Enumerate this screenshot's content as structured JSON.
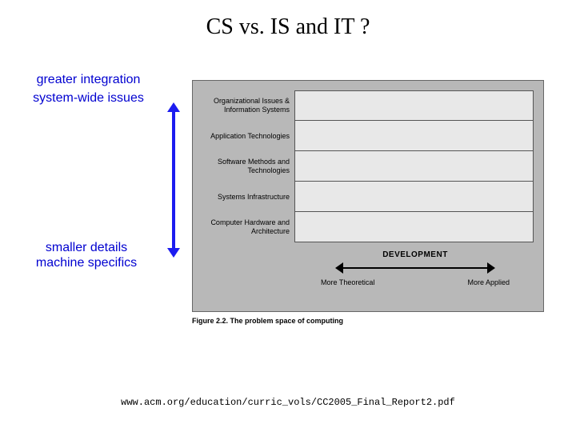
{
  "title": "CS vs. IS and IT  ?",
  "annotations": {
    "top_line1": "greater integration",
    "top_line2": "system-wide issues",
    "bottom_line1": "smaller details",
    "bottom_line2": "machine specifics"
  },
  "figure": {
    "rows": [
      "Organizational Issues & Information Systems",
      "Application Technologies",
      "Software Methods and Technologies",
      "Systems Infrastructure",
      "Computer Hardware and Architecture"
    ],
    "development_label": "DEVELOPMENT",
    "axis_left": "More Theoretical",
    "axis_right": "More Applied",
    "caption": "Figure 2.2.  The problem space of computing"
  },
  "footer": "www.acm.org/education/curric_vols/CC2005_Final_Report2.pdf"
}
